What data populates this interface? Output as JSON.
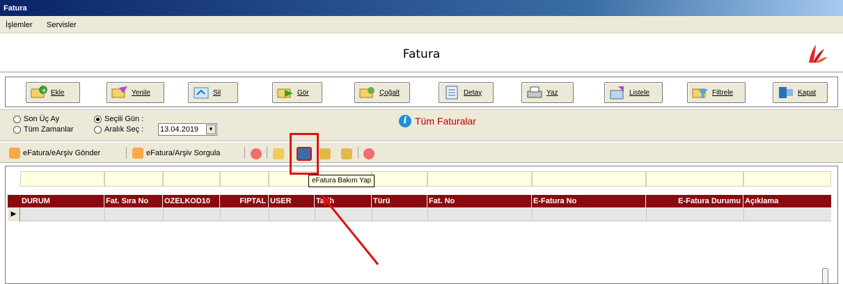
{
  "window": {
    "title": "Fatura"
  },
  "menu": {
    "items": [
      "İşlemler",
      "Servisler"
    ]
  },
  "banner": {
    "title": "Fatura"
  },
  "toolbar": {
    "buttons": [
      {
        "label": "Ekle",
        "icon": "add-icon"
      },
      {
        "label": "Yenile",
        "icon": "new-icon"
      },
      {
        "label": "Sil",
        "icon": "delete-icon"
      },
      {
        "label": "Gör",
        "icon": "view-icon"
      },
      {
        "label": "Çoğalt",
        "icon": "duplicate-icon"
      },
      {
        "label": "Detay",
        "icon": "detail-icon"
      },
      {
        "label": "Yaz",
        "icon": "print-icon"
      },
      {
        "label": "Listele",
        "icon": "list-icon"
      },
      {
        "label": "Filtrele",
        "icon": "filter-icon"
      },
      {
        "label": "Kapat",
        "icon": "close-icon"
      }
    ]
  },
  "filters": {
    "son_uc_ay": "Son Üç Ay",
    "tum_zamanlar": "Tüm Zamanlar",
    "secili_gun": "Seçili Gün :",
    "aralik_sec": "Aralık Seç :",
    "date_value": "13.04.2019",
    "info_text": "Tüm Faturalar"
  },
  "strip": {
    "send_label": "eFatura/eArşiv Gönder",
    "query_label": "eFatura/Arşiv Sorgula",
    "tooltip": "eFatura Bakım Yap"
  },
  "grid": {
    "columns": [
      "DURUM",
      "Fat. Sıra No",
      "OZELKOD10",
      "FIPTAL",
      "USER",
      "Tarih",
      "Türü",
      "Fat. No",
      "E-Fatura No",
      "E-Fatura Durumu",
      "Açıklama"
    ]
  },
  "colors": {
    "header": "#8b0a10",
    "title_gradient_start": "#0a246a",
    "highlight": "#e01010"
  }
}
